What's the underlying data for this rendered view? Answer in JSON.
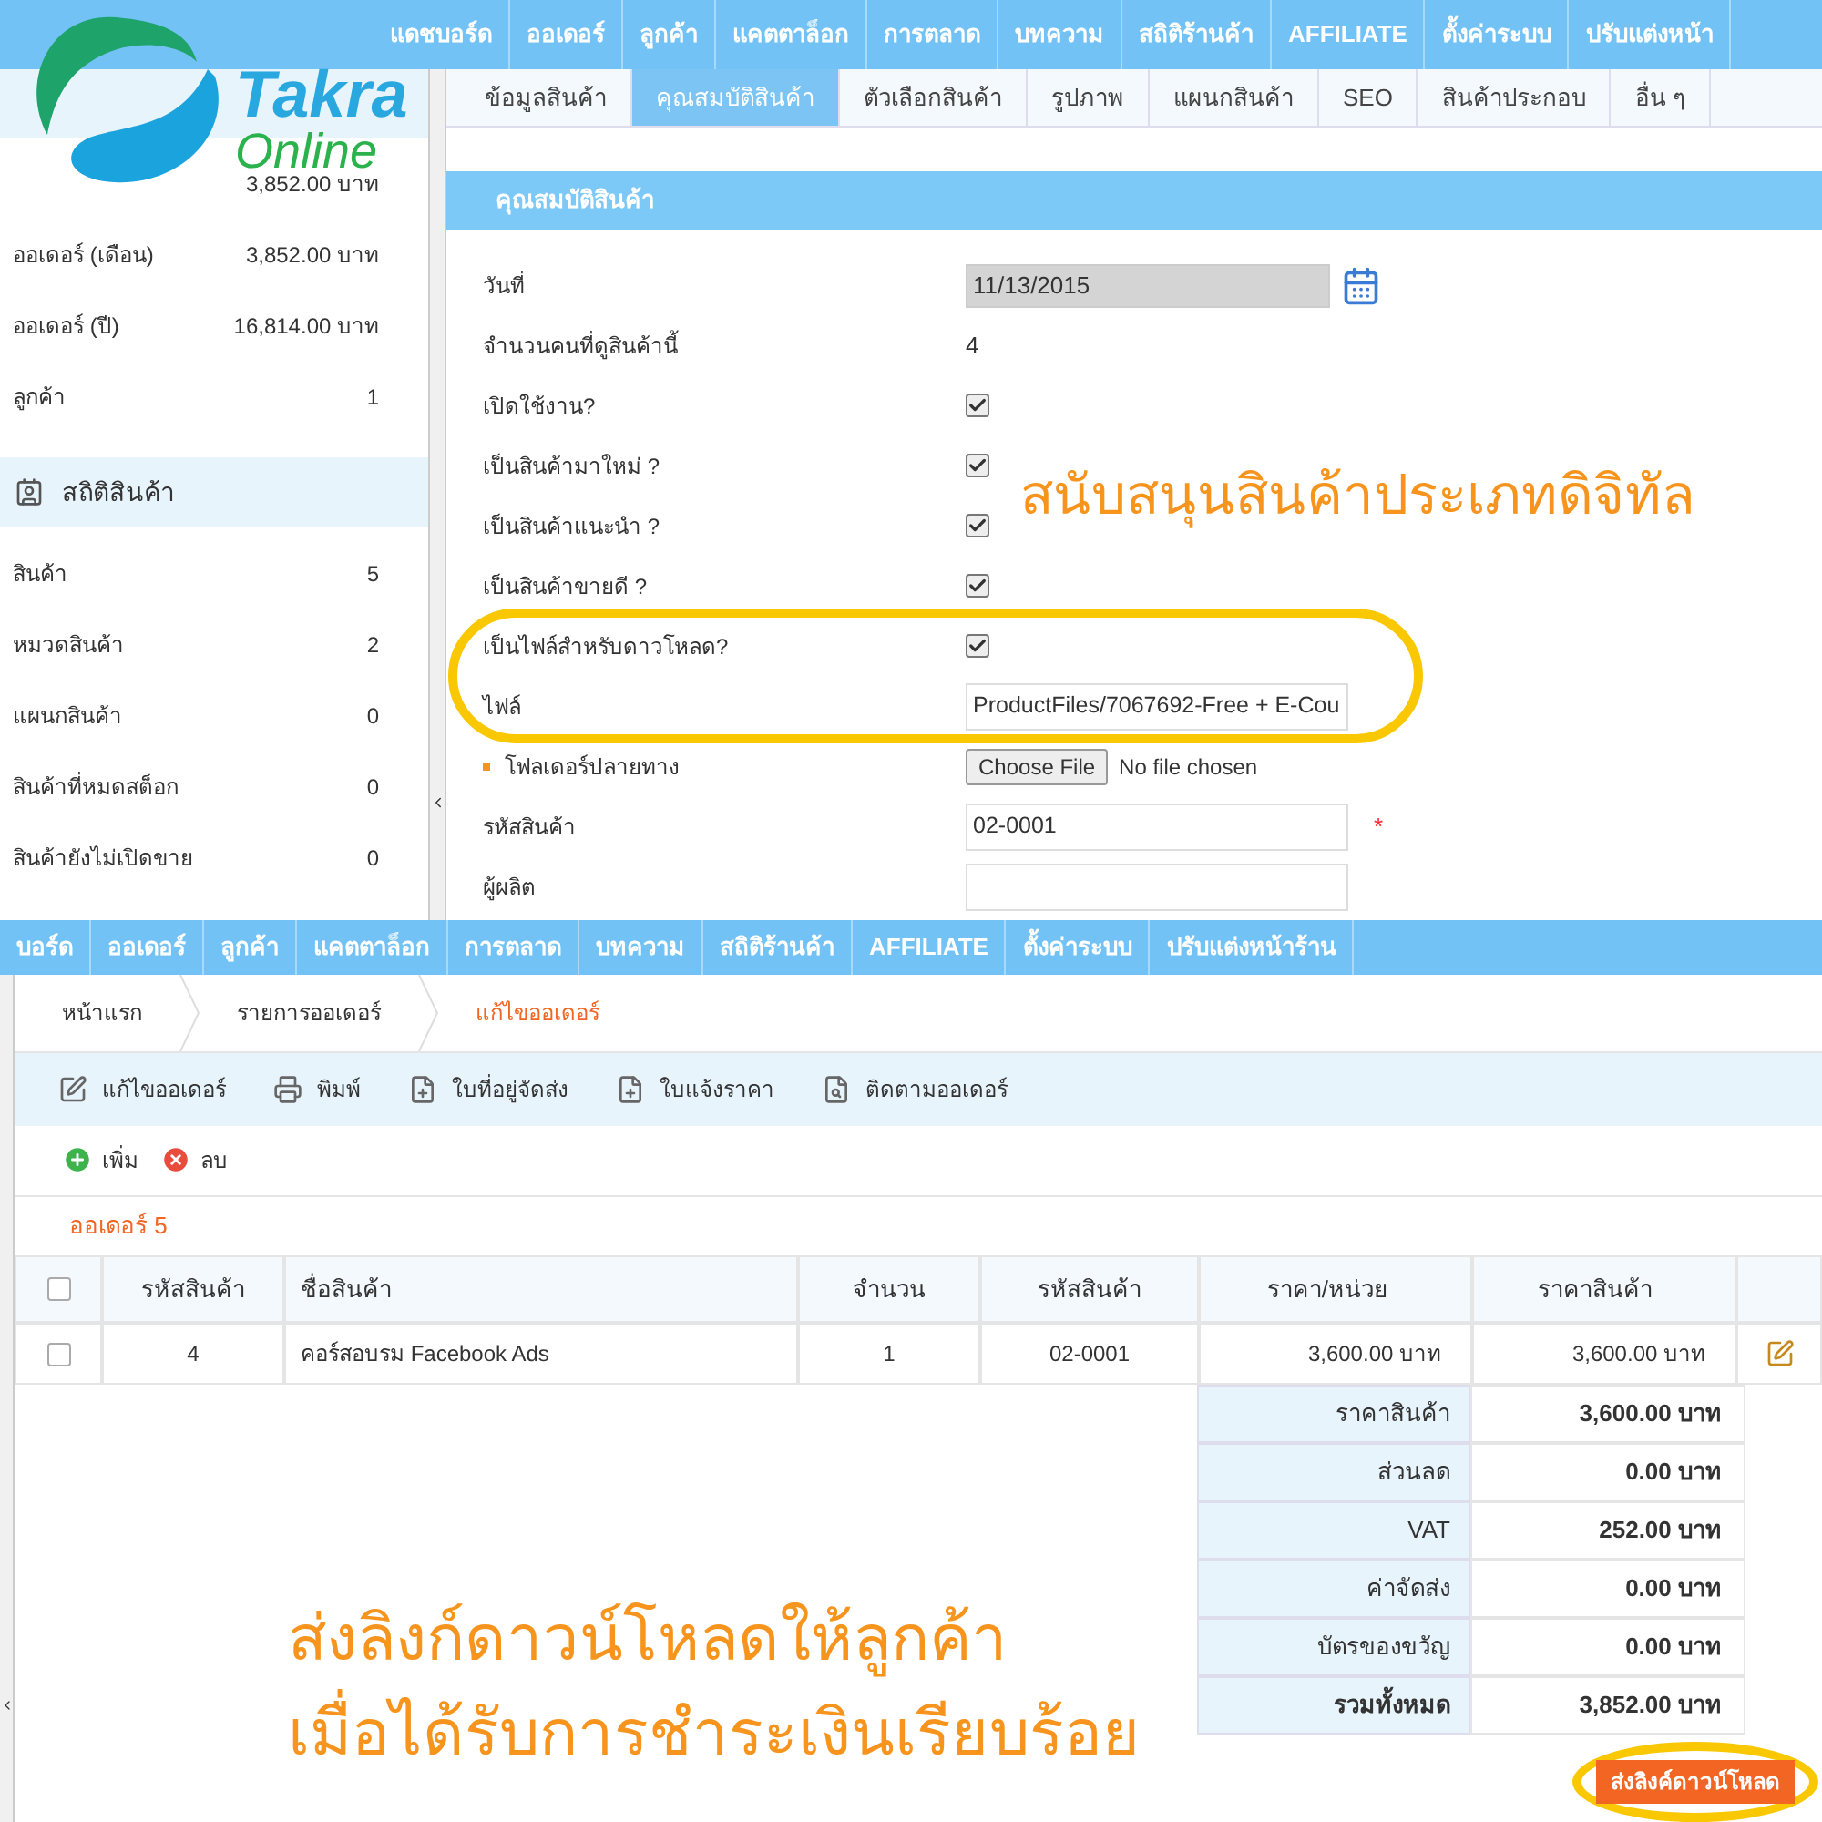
{
  "logo": {
    "line_1": "Takra",
    "line_2": "Online"
  },
  "product_screen": {
    "nav": [
      "แดชบอร์ด",
      "ออเดอร์",
      "ลูกค้า",
      "แคตตาล็อก",
      "การตลาด",
      "บทความ",
      "สถิติร้านค้า",
      "AFFILIATE",
      "ตั้งค่าระบบ",
      "ปรับแต่งหน้า"
    ],
    "sidebar": {
      "sections": [
        {
          "rows": [
            {
              "value": "3,852.00 บาท"
            },
            {
              "label": "ออเดอร์ (เดือน)",
              "value": "3,852.00 บาท"
            },
            {
              "label": "ออเดอร์ (ปี)",
              "value": "16,814.00 บาท"
            },
            {
              "label": "ลูกค้า",
              "value": "1"
            }
          ]
        },
        {
          "title": "สถิติสินค้า",
          "rows": [
            {
              "label": "สินค้า",
              "value": "5"
            },
            {
              "label": "หมวดสินค้า",
              "value": "2"
            },
            {
              "label": "แผนกสินค้า",
              "value": "0"
            },
            {
              "label": "สินค้าที่หมดสต็อก",
              "value": "0"
            },
            {
              "label": "สินค้ายังไม่เปิดขาย",
              "value": "0"
            }
          ]
        }
      ]
    },
    "tabs": [
      {
        "label": "ข้อมูลสินค้า",
        "selected": false
      },
      {
        "label": "คุณสมบัติสินค้า",
        "selected": true
      },
      {
        "label": "ตัวเลือกสินค้า",
        "selected": false
      },
      {
        "label": "รูปภาพ",
        "selected": false
      },
      {
        "label": "แผนกสินค้า",
        "selected": false
      },
      {
        "label": "SEO",
        "selected": false
      },
      {
        "label": "สินค้าประกอบ",
        "selected": false
      },
      {
        "label": "อื่น ๆ",
        "selected": false
      }
    ],
    "panel_title": "คุณสมบัติสินค้า",
    "fields": [
      {
        "kind": "date",
        "label": "วันที่",
        "value": "11/13/2015"
      },
      {
        "kind": "text",
        "label": "จำนวนคนที่ดูสินค้านี้",
        "value": "4"
      },
      {
        "kind": "checkbox",
        "label": "เปิดใช้งาน?",
        "checked": true
      },
      {
        "kind": "checkbox",
        "label": "เป็นสินค้ามาใหม่ ?",
        "checked": true
      },
      {
        "kind": "checkbox",
        "label": "เป็นสินค้าแนะนำ ?",
        "checked": true
      },
      {
        "kind": "checkbox",
        "label": "เป็นสินค้าขายดี ?",
        "checked": true
      },
      {
        "kind": "checkbox",
        "label": "เป็นไฟล์สำหรับดาวโหลด?",
        "checked": true
      },
      {
        "kind": "input",
        "label": "ไฟล์",
        "value": "ProductFiles/7067692-Free + E-Cou"
      },
      {
        "kind": "file",
        "label": "โฟลเดอร์ปลายทาง",
        "button": "Choose File",
        "status": "No file chosen"
      },
      {
        "kind": "input",
        "label": "รหัสสินค้า",
        "value": "02-0001",
        "required_mark": "*"
      },
      {
        "kind": "input",
        "label": "ผู้ผลิต"
      }
    ]
  },
  "order_screen": {
    "nav": [
      "บอร์ด",
      "ออเดอร์",
      "ลูกค้า",
      "แคตตาล็อก",
      "การตลาด",
      "บทความ",
      "สถิติร้านค้า",
      "AFFILIATE",
      "ตั้งค่าระบบ",
      "ปรับแต่งหน้าร้าน"
    ],
    "breadcrumb": [
      {
        "label": "หน้าแรก",
        "current": false
      },
      {
        "label": "รายการออเดอร์",
        "current": false
      },
      {
        "label": "แก้ไขออเดอร์",
        "current": true
      }
    ],
    "toolbar": [
      "แก้ไขออเดอร์",
      "พิมพ์",
      "ใบที่อยู่จัดส่ง",
      "ใบแจ้งราคา",
      "ติดตามออเดอร์"
    ],
    "actions": [
      "เพิ่ม",
      "ลบ"
    ],
    "order_title": "ออเดอร์ 5",
    "table": {
      "header_checked": false,
      "columns": [
        "รหัสสินค้า",
        "ชื่อสินค้า",
        "จำนวน",
        "รหัสสินค้า",
        "ราคา/หน่วย",
        "ราคาสินค้า"
      ],
      "rows": [
        {
          "checked": false,
          "cells": [
            "4",
            "คอร์สอบรม Facebook Ads",
            "1",
            "02-0001",
            "3,600.00 บาท",
            "3,600.00 บาท"
          ]
        }
      ]
    },
    "totals": [
      {
        "kind": "line",
        "label": "ราคาสินค้า",
        "value": "3,600.00 บาท"
      },
      {
        "kind": "line",
        "label": "ส่วนลด",
        "value": "0.00 บาท"
      },
      {
        "kind": "line",
        "label": "VAT",
        "value": "252.00 บาท"
      },
      {
        "kind": "line",
        "label": "ค่าจัดส่ง",
        "value": "0.00 บาท"
      },
      {
        "kind": "line",
        "label": "บัตรของขวัญ",
        "value": "0.00 บาท"
      },
      {
        "kind": "total",
        "label": "รวมทั้งหมด",
        "value": "3,852.00 บาท"
      }
    ],
    "send_button": "ส่งลิงค์ดาวน์โหลด"
  },
  "annotations": {
    "top": "สนับสนุนสินค้าประเภทดิจิทัล",
    "bottom": [
      "ส่งลิงก์ดาวน์โหลดให้ลูกค้า",
      "เมื่อได้รับการชำระเงินเรียบร้อย"
    ]
  }
}
